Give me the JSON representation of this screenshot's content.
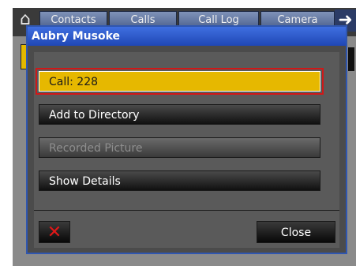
{
  "background": {
    "tabs": [
      "Contacts",
      "Calls",
      "Call Log",
      "Camera"
    ]
  },
  "dialog": {
    "title": "Aubry Musoke",
    "options": [
      "Call: 228",
      "Add to Directory",
      "Recorded Picture",
      "Show Details"
    ],
    "close_label": "Close",
    "cancel_icon": "x-icon"
  },
  "colors": {
    "title_bar": "#1f47b5",
    "selected": "#e6b800",
    "selection_outline": "#d01818"
  }
}
